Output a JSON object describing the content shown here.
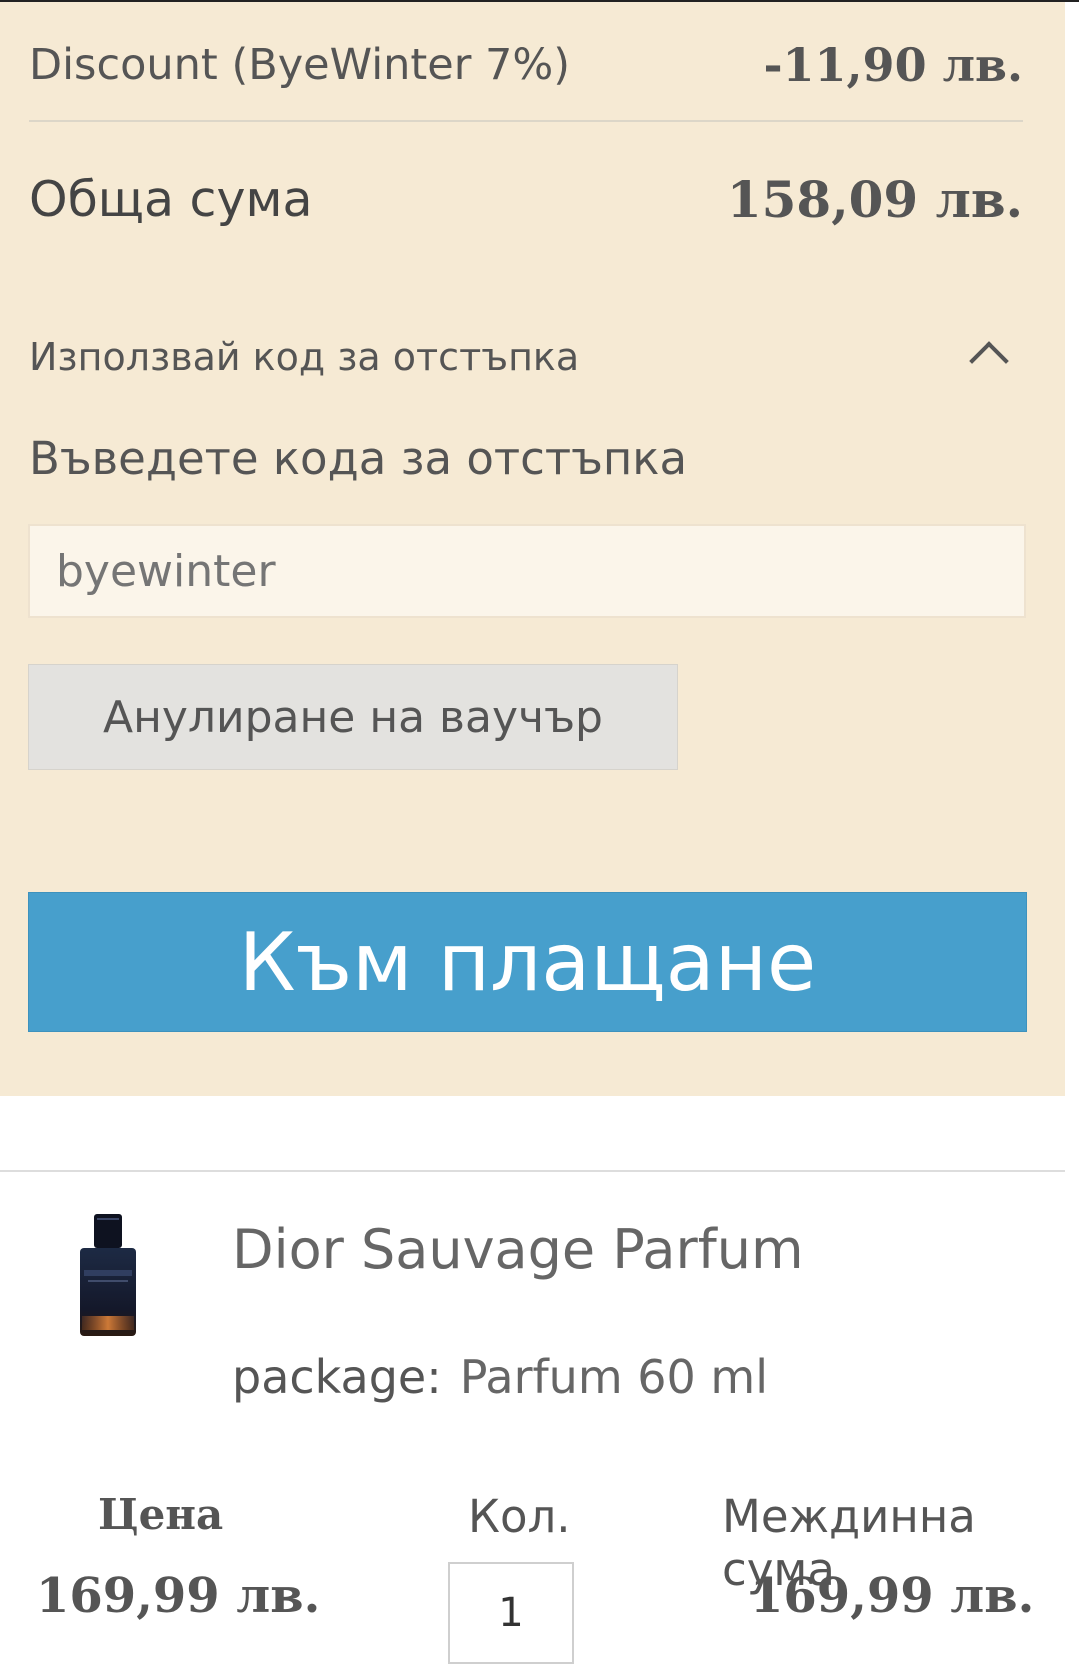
{
  "summary": {
    "discount": {
      "label": "Discount (ByeWinter 7%)",
      "value": "-11,90 лв."
    },
    "total": {
      "label": "Обща сума",
      "value": "158,09 лв."
    },
    "coupon": {
      "toggle_label": "Използвай код за отстъпка",
      "toggle_icon": "chevron-up-icon",
      "expanded": true,
      "enter_label": "Въведете кода за отстъпка",
      "input_placeholder": "byewinter",
      "cancel_label": "Анулиране на ваучър"
    },
    "checkout_label": "Към плащане"
  },
  "product": {
    "name": "Dior Sauvage Parfum",
    "image_icon": "perfume-bottle-image",
    "option_label": "package:",
    "option_value": "Parfum 60 ml",
    "price_header": "Цена",
    "price": "169,99 лв.",
    "qty_header": "Кол.",
    "qty": "1",
    "subtotal_header": "Междинна сума",
    "subtotal": "169,99 лв."
  },
  "colors": {
    "summary_background": "#f6ead4",
    "checkout_button": "#479fcc",
    "cancel_button": "#e3e2df"
  }
}
